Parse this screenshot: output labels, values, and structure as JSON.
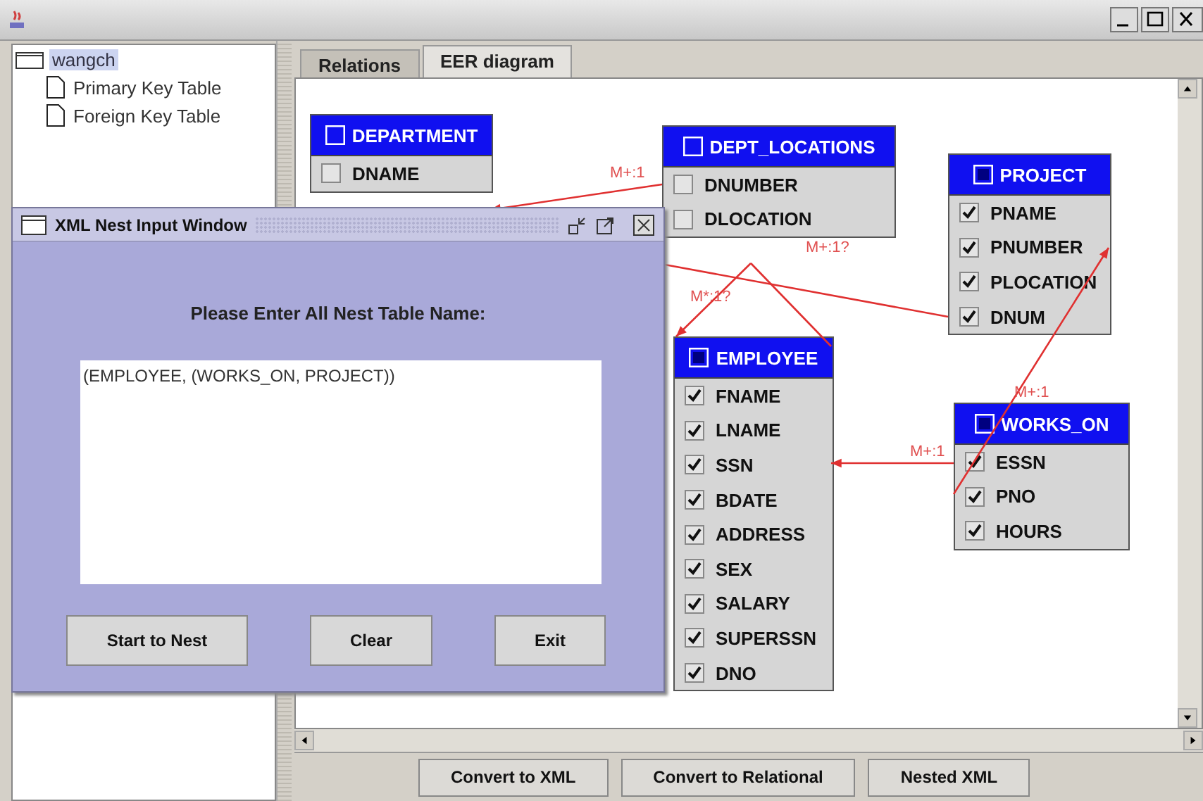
{
  "tree": {
    "root": {
      "label": "wangch",
      "selected": true,
      "children": [
        {
          "label": "Primary Key Table",
          "selected": false
        },
        {
          "label": "Foreign Key Table",
          "selected": false
        }
      ]
    }
  },
  "tabs": [
    {
      "label": "Relations",
      "selected": false
    },
    {
      "label": "EER diagram",
      "selected": true
    }
  ],
  "diagram": {
    "tables": [
      {
        "name": "DEPARTMENT",
        "checked": false,
        "fields": [
          {
            "name": "DNAME",
            "checked": false
          }
        ]
      },
      {
        "name": "DEPT_LOCATIONS",
        "checked": false,
        "fields": [
          {
            "name": "DNUMBER",
            "checked": false
          },
          {
            "name": "DLOCATION",
            "checked": false
          }
        ]
      },
      {
        "name": "PROJECT",
        "checked": true,
        "fields": [
          {
            "name": "PNAME",
            "checked": true
          },
          {
            "name": "PNUMBER",
            "checked": true
          },
          {
            "name": "PLOCATION",
            "checked": true
          },
          {
            "name": "DNUM",
            "checked": true
          }
        ]
      },
      {
        "name": "EMPLOYEE",
        "checked": true,
        "fields": [
          {
            "name": "FNAME",
            "checked": true
          },
          {
            "name": "LNAME",
            "checked": true
          },
          {
            "name": "SSN",
            "checked": true
          },
          {
            "name": "BDATE",
            "checked": true
          },
          {
            "name": "ADDRESS",
            "checked": true
          },
          {
            "name": "SEX",
            "checked": true
          },
          {
            "name": "SALARY",
            "checked": true
          },
          {
            "name": "SUPERSSN",
            "checked": true
          },
          {
            "name": "DNO",
            "checked": true
          }
        ]
      },
      {
        "name": "WORKS_ON",
        "checked": true,
        "fields": [
          {
            "name": "ESSN",
            "checked": true
          },
          {
            "name": "PNO",
            "checked": true
          },
          {
            "name": "HOURS",
            "checked": true
          }
        ]
      }
    ],
    "relationships": [
      {
        "label": "M+:1"
      },
      {
        "label": "M+:1?"
      },
      {
        "label": "M*:1?"
      },
      {
        "label": "M+:1"
      },
      {
        "label": "M+:1"
      }
    ]
  },
  "bottom_buttons": [
    "Convert to XML",
    "Convert to Relational",
    "Nested XML"
  ],
  "dialog": {
    "title": "XML Nest Input Window",
    "prompt": "Please Enter All Nest Table Name:",
    "value": "(EMPLOYEE, (WORKS_ON, PROJECT))",
    "buttons": [
      "Start to Nest",
      "Clear",
      "Exit"
    ]
  }
}
